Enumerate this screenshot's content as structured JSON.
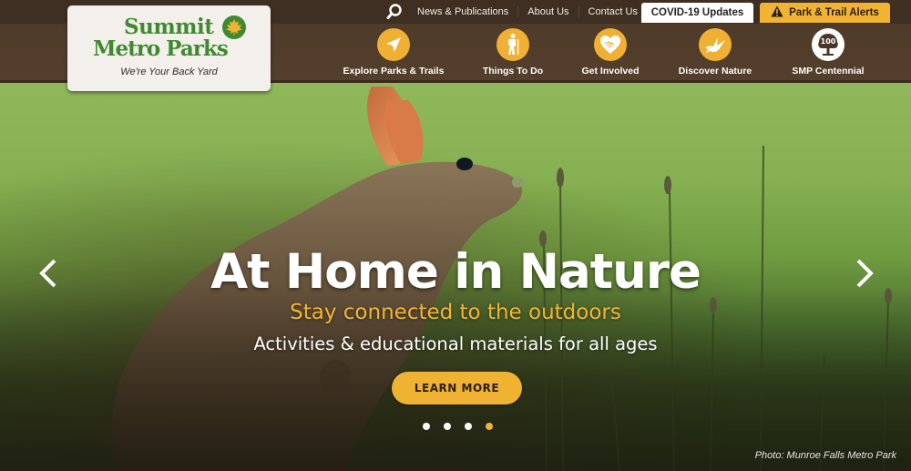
{
  "logo": {
    "line1": "Summit",
    "line2": "Metro Parks",
    "tagline": "We're Your Back Yard"
  },
  "utility_nav": {
    "search_icon": "search-icon",
    "links": [
      "News & Publications",
      "About Us",
      "Contact Us"
    ]
  },
  "buttons": {
    "covid": "COVID-19 Updates",
    "alerts": "Park & Trail Alerts"
  },
  "main_nav": [
    {
      "label": "Explore Parks & Trails",
      "icon": "navigation-arrow-icon"
    },
    {
      "label": "Things To Do",
      "icon": "hiker-icon"
    },
    {
      "label": "Get Involved",
      "icon": "heart-handshake-icon"
    },
    {
      "label": "Discover Nature",
      "icon": "bird-icon"
    },
    {
      "label": "SMP Centennial",
      "icon": "centennial-tree-icon",
      "badge": "100"
    }
  ],
  "hero": {
    "title": "At Home in Nature",
    "subtitle": "Stay connected to the outdoors",
    "description": "Activities & educational materials for all ages",
    "cta": "LEARN MORE",
    "slide_count": 4,
    "active_slide": 4,
    "credit": "Photo: Munroe Falls Metro Park"
  },
  "colors": {
    "header_brown": "#4f3b29",
    "accent_gold": "#f0b233",
    "logo_green": "#3f8a2f",
    "logo_bg": "#f3efea"
  }
}
